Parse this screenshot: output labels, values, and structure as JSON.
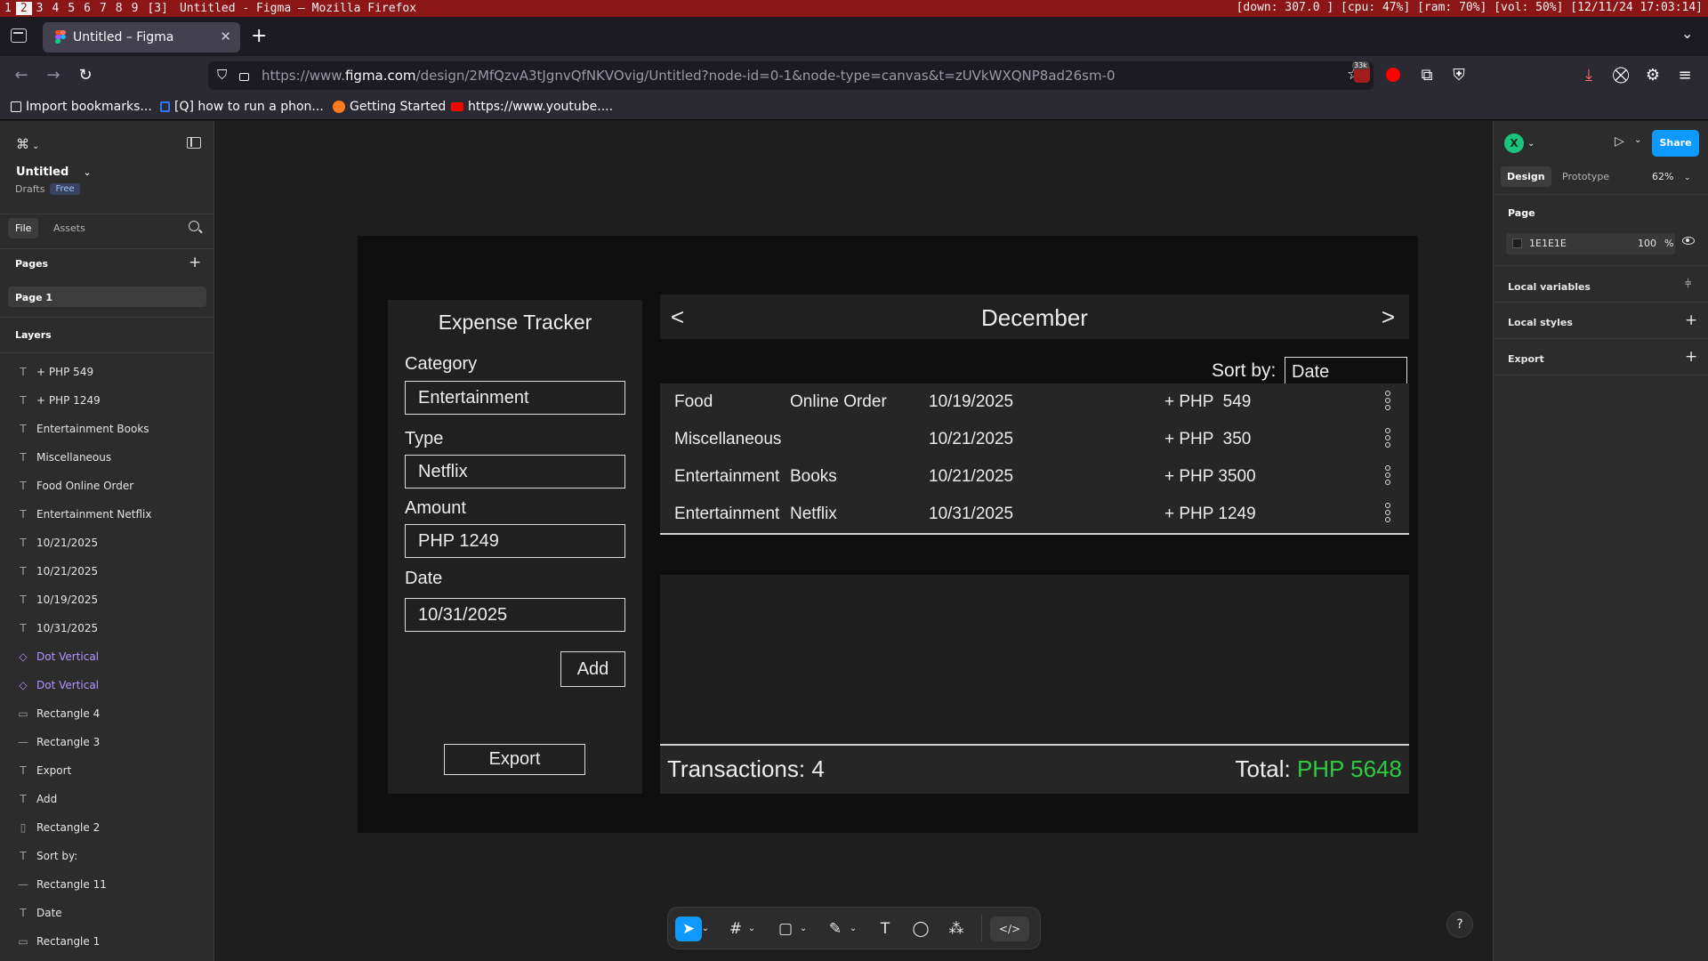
{
  "system_bar": {
    "workspaces": [
      "1",
      "2",
      "3",
      "4",
      "5",
      "6",
      "7",
      "8",
      "9",
      "[3]"
    ],
    "active_workspace": "2",
    "window_title": "Untitled - Figma — Mozilla Firefox",
    "stats": "[down:  307.0 ] [cpu: 47%] [ram: 70%] [vol: 50%] [12/11/24 17:03:14]"
  },
  "browser": {
    "tab_title": "Untitled – Figma",
    "url_prefix": "https://www.",
    "url_host": "figma.com",
    "url_rest": "/design/2MfQzvA3tJgnvQfNKVOvig/Untitled?node-id=0-1&node-type=canvas&t=zUVkWXQNP8ad26sm-0",
    "extension_badge": "33k",
    "bookmarks": [
      {
        "label": "Import bookmarks...",
        "icon": "import-icon"
      },
      {
        "label": "[Q] how to run a phon...",
        "icon": "q-icon"
      },
      {
        "label": "Getting Started",
        "icon": "firefox-icon"
      },
      {
        "label": "https://www.youtube....",
        "icon": "youtube-icon"
      }
    ]
  },
  "figma": {
    "file_name": "Untitled",
    "drafts_label": "Drafts",
    "plan_badge": "Free",
    "left_tabs": {
      "file": "File",
      "assets": "Assets"
    },
    "pages_heading": "Pages",
    "pages": [
      "Page 1"
    ],
    "layers_heading": "Layers",
    "layers": [
      {
        "name": "+ PHP 549",
        "icon": "text-icon",
        "glyph": "T",
        "component": false
      },
      {
        "name": "+ PHP 1249",
        "icon": "text-icon",
        "glyph": "T",
        "component": false
      },
      {
        "name": "Entertainment Books",
        "icon": "text-icon",
        "glyph": "T",
        "component": false
      },
      {
        "name": "Miscellaneous",
        "icon": "text-icon",
        "glyph": "T",
        "component": false
      },
      {
        "name": "Food Online Order",
        "icon": "text-icon",
        "glyph": "T",
        "component": false
      },
      {
        "name": "Entertainment Netflix",
        "icon": "text-icon",
        "glyph": "T",
        "component": false
      },
      {
        "name": "10/21/2025",
        "icon": "text-icon",
        "glyph": "T",
        "component": false
      },
      {
        "name": "10/21/2025",
        "icon": "text-icon",
        "glyph": "T",
        "component": false
      },
      {
        "name": "10/19/2025",
        "icon": "text-icon",
        "glyph": "T",
        "component": false
      },
      {
        "name": "10/31/2025",
        "icon": "text-icon",
        "glyph": "T",
        "component": false
      },
      {
        "name": "Dot Vertical",
        "icon": "component-instance-icon",
        "glyph": "◇",
        "component": true
      },
      {
        "name": "Dot Vertical",
        "icon": "component-instance-icon",
        "glyph": "◇",
        "component": true
      },
      {
        "name": "Rectangle 4",
        "icon": "rectangle-icon",
        "glyph": "▭",
        "component": false
      },
      {
        "name": "Rectangle 3",
        "icon": "line-icon",
        "glyph": "—",
        "component": false
      },
      {
        "name": "Export",
        "icon": "text-icon",
        "glyph": "T",
        "component": false
      },
      {
        "name": "Add",
        "icon": "text-icon",
        "glyph": "T",
        "component": false
      },
      {
        "name": "Rectangle 2",
        "icon": "rectangle-icon",
        "glyph": "▯",
        "component": false
      },
      {
        "name": "Sort by:",
        "icon": "text-icon",
        "glyph": "T",
        "component": false
      },
      {
        "name": "Rectangle 11",
        "icon": "line-icon",
        "glyph": "—",
        "component": false
      },
      {
        "name": "Date",
        "icon": "text-icon",
        "glyph": "T",
        "component": false
      },
      {
        "name": "Rectangle 1",
        "icon": "rectangle-icon",
        "glyph": "▭",
        "component": false
      }
    ],
    "right_panel": {
      "avatar_initial": "X",
      "avatar_color": "#1bc47d",
      "share_label": "Share",
      "tab_design": "Design",
      "tab_prototype": "Prototype",
      "zoom": "62%",
      "page_heading": "Page",
      "page_color_hex": "1E1E1E",
      "page_opacity": "100",
      "page_opacity_unit": "%",
      "local_variables": "Local variables",
      "local_styles": "Local styles",
      "export": "Export"
    },
    "help_label": "?"
  },
  "design": {
    "tracker_title": "Expense Tracker",
    "category_label": "Category",
    "category_value": "Entertainment",
    "type_label": "Type",
    "type_value": "Netflix",
    "amount_label": "Amount",
    "amount_value": "PHP 1249",
    "date_label": "Date",
    "date_value": "10/31/2025",
    "add_label": "Add",
    "export_label": "Export",
    "prev_label": "<",
    "next_label": ">",
    "month": "December",
    "sort_label": "Sort by:",
    "sort_value": "Date",
    "transactions": [
      {
        "category": "Food",
        "type": "Online Order",
        "date": "10/19/2025",
        "amount": "+ PHP  549"
      },
      {
        "category": "Miscellaneous",
        "type": "",
        "date": "10/21/2025",
        "amount": "+ PHP  350"
      },
      {
        "category": "Entertainment",
        "type": "Books",
        "date": "10/21/2025",
        "amount": "+ PHP 3500"
      },
      {
        "category": "Entertainment",
        "type": "Netflix",
        "date": "10/31/2025",
        "amount": "+ PHP 1249"
      }
    ],
    "transactions_label": "Transactions: 4",
    "total_label": "Total:",
    "total_value": "PHP 5648",
    "total_color": "#2ecc40"
  }
}
